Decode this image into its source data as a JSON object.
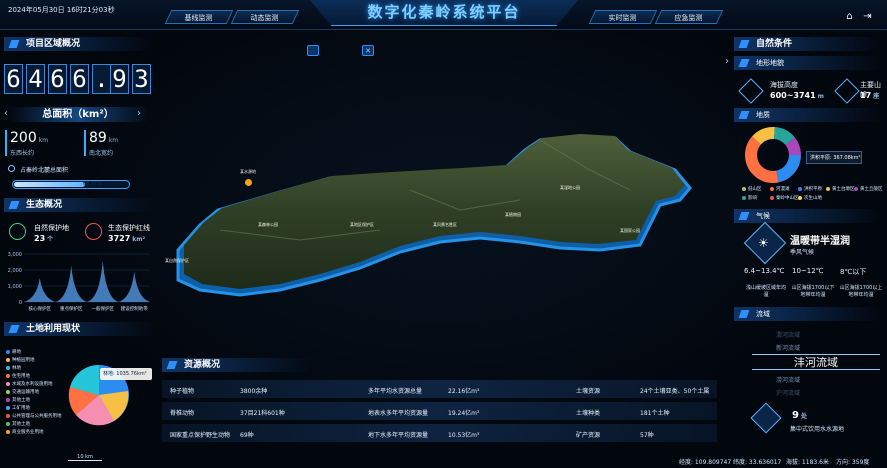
{
  "header": {
    "datetime": "2024年05月30日 16时21分03秒",
    "title": "数字化秦岭系统平台",
    "tabs": [
      "基线监测",
      "动态监测",
      "实时监测",
      "应急监测"
    ],
    "icons": [
      "home-icon",
      "exit-icon"
    ]
  },
  "left": {
    "area_title": "项目区域概况",
    "digits": [
      "6",
      "4",
      "6",
      "6",
      ".",
      "9",
      "3"
    ],
    "total_label": "总面积（km²）",
    "ew_value": "200",
    "ew_unit": "km",
    "ew_label": "东西长约",
    "ns_value": "89",
    "ns_unit": "km",
    "ns_label": "南北宽约",
    "share_label": "占秦岭北麓总面积",
    "share_percent": "62.27%",
    "share_fraction": 0.6227,
    "eco_title": "生态概况",
    "reserve_label": "自然保护地",
    "reserve_value": "23",
    "reserve_unit": "个",
    "redline_label": "生态保护红线",
    "redline_value": "3727",
    "redline_unit": "km²",
    "eco_chart": {
      "type": "area",
      "categories": [
        "核心保护区",
        "重点保护区",
        "一般保护区",
        "建设控制地带"
      ],
      "values": [
        1500,
        2300,
        2600,
        1900
      ],
      "yticks": [
        "3,000",
        "2,000",
        "1,000",
        "0"
      ],
      "ylim": [
        0,
        3000
      ]
    },
    "landuse_title": "土地利用现状",
    "landuse_legend": [
      "耕地",
      "种植园用地",
      "林地",
      "住宅用地",
      "水域及水利设施用地",
      "交通运输用地",
      "其他土地",
      "工矿用地",
      "公共管理与公共服务用地",
      "其他土地",
      "商业服务业用地"
    ],
    "landuse_callout": "林地: 1035.76km²",
    "scale_label": "10 km"
  },
  "right": {
    "nature_title": "自然条件",
    "terrain_title": "地形地貌",
    "altitude_label": "海拔高度",
    "altitude_value": "600~3741",
    "altitude_unit": "m",
    "peaks_label": "主要山峰",
    "peaks_value": "17",
    "peaks_unit": "座",
    "geology_title": "地质",
    "geology_callout": "洪积平原: 367.08km²",
    "geology_legend": [
      "低山区",
      "河漫滩",
      "洪积平原",
      "黄土台塬区",
      "黄土丘陵区",
      "影响",
      "秦岭中山区",
      "次生山地"
    ],
    "climate_title": "气候",
    "climate_name": "温暖带半湿润",
    "climate_sub": "季风气候",
    "temp1_value": "6.4~13.4℃",
    "temp1_label": "浅山缓坡区域年均温",
    "temp2_value": "10~12℃",
    "temp2_label": "山区海拔1700以下地带年均温",
    "temp3_value": "8℃以下",
    "temp3_label": "山区海拔1700以上地带年均温",
    "basin_title": "流域",
    "basins": [
      "渭河流域",
      "新河流域",
      "沣河流域",
      "涝河流域",
      "沪河流域"
    ],
    "selected_basin": "沣河流域",
    "water_value": "9",
    "water_unit": "处",
    "water_label": "集中式饮用水水源地"
  },
  "resources": {
    "title": "资源概况",
    "rows": [
      [
        "种子植物",
        "3800余种",
        "多年平均水资源总量",
        "22.16亿m³",
        "土壤资源",
        "24个土壤亚类、50个土属"
      ],
      [
        "脊椎动物",
        "37目21科601种",
        "地表水多年平均资源量",
        "19.24亿m³",
        "土壤种类",
        "181个土种"
      ],
      [
        "国家重点保护野生动物",
        "69种",
        "地下水多年平均资源量",
        "10.53亿m³",
        "矿产资源",
        "57种"
      ]
    ]
  },
  "map": {
    "marker_label": "某水源地",
    "labels": [
      "某自然保护区",
      "某森林公园",
      "某地区保护区",
      "某风景名胜区",
      "某植物园",
      "某湿地公园",
      "某国家公园"
    ]
  },
  "status": {
    "lon": "经度: 109.809747",
    "lat": "纬度: 33.636017",
    "alt": "海拔: 1183.6米",
    "dir": "方向: 359度"
  },
  "colors": {
    "accent": "#2f8fff",
    "title": "#7fd0ff",
    "bg": "#02060d"
  }
}
